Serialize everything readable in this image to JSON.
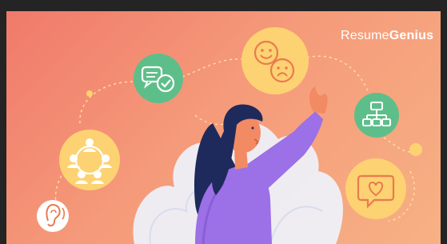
{
  "brand": {
    "name_light": "Resume",
    "name_bold": "Genius"
  },
  "colors": {
    "background_top": "#f07a6a",
    "background_bottom": "#f7b184",
    "yellow_circle": "#fdd272",
    "green_circle": "#5ebe8a",
    "purple_shirt": "#9c70e6",
    "hair": "#1e2a5c",
    "skin": "#f28a64"
  },
  "icons": [
    "chat-bubbles-check-icon",
    "smile-sad-faces-icon",
    "org-chart-icon",
    "team-network-icon",
    "heart-message-icon",
    "ear-listening-icon"
  ]
}
